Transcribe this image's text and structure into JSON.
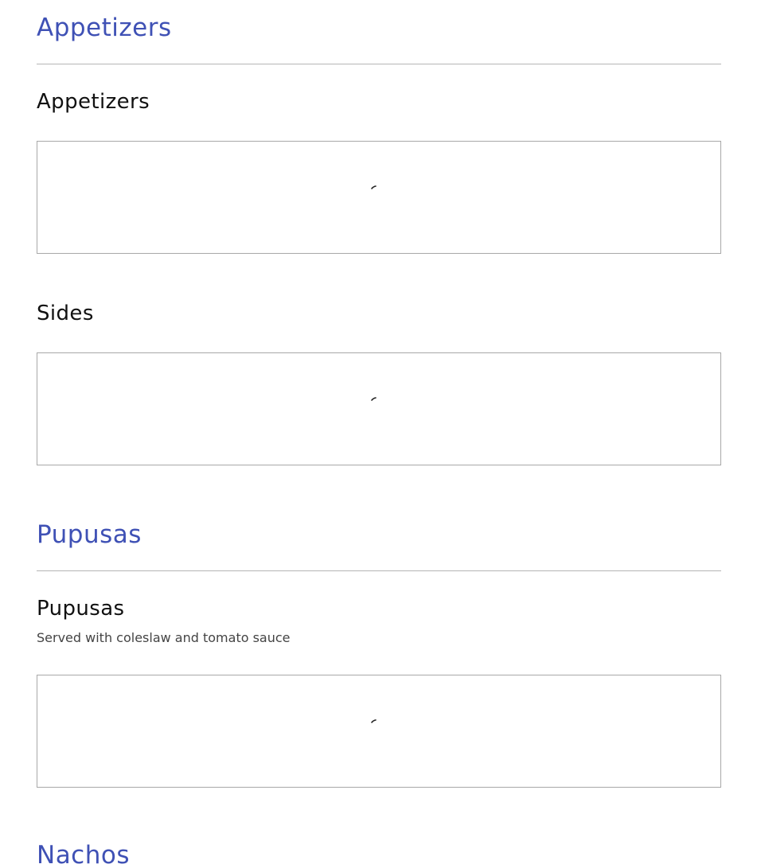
{
  "accent_color": "#3f51b5",
  "sections": [
    {
      "title": "Appetizers",
      "subsections": [
        {
          "title": "Appetizers",
          "description": "",
          "content_state": "loading",
          "spinner_icon": "loading-spinner-icon"
        },
        {
          "title": "Sides",
          "description": "",
          "content_state": "loading",
          "spinner_icon": "loading-spinner-icon"
        }
      ]
    },
    {
      "title": "Pupusas",
      "subsections": [
        {
          "title": "Pupusas",
          "description": "Served with coleslaw and tomato sauce",
          "content_state": "loading",
          "spinner_icon": "loading-spinner-icon"
        }
      ]
    },
    {
      "title": "Nachos",
      "subsections": []
    }
  ]
}
